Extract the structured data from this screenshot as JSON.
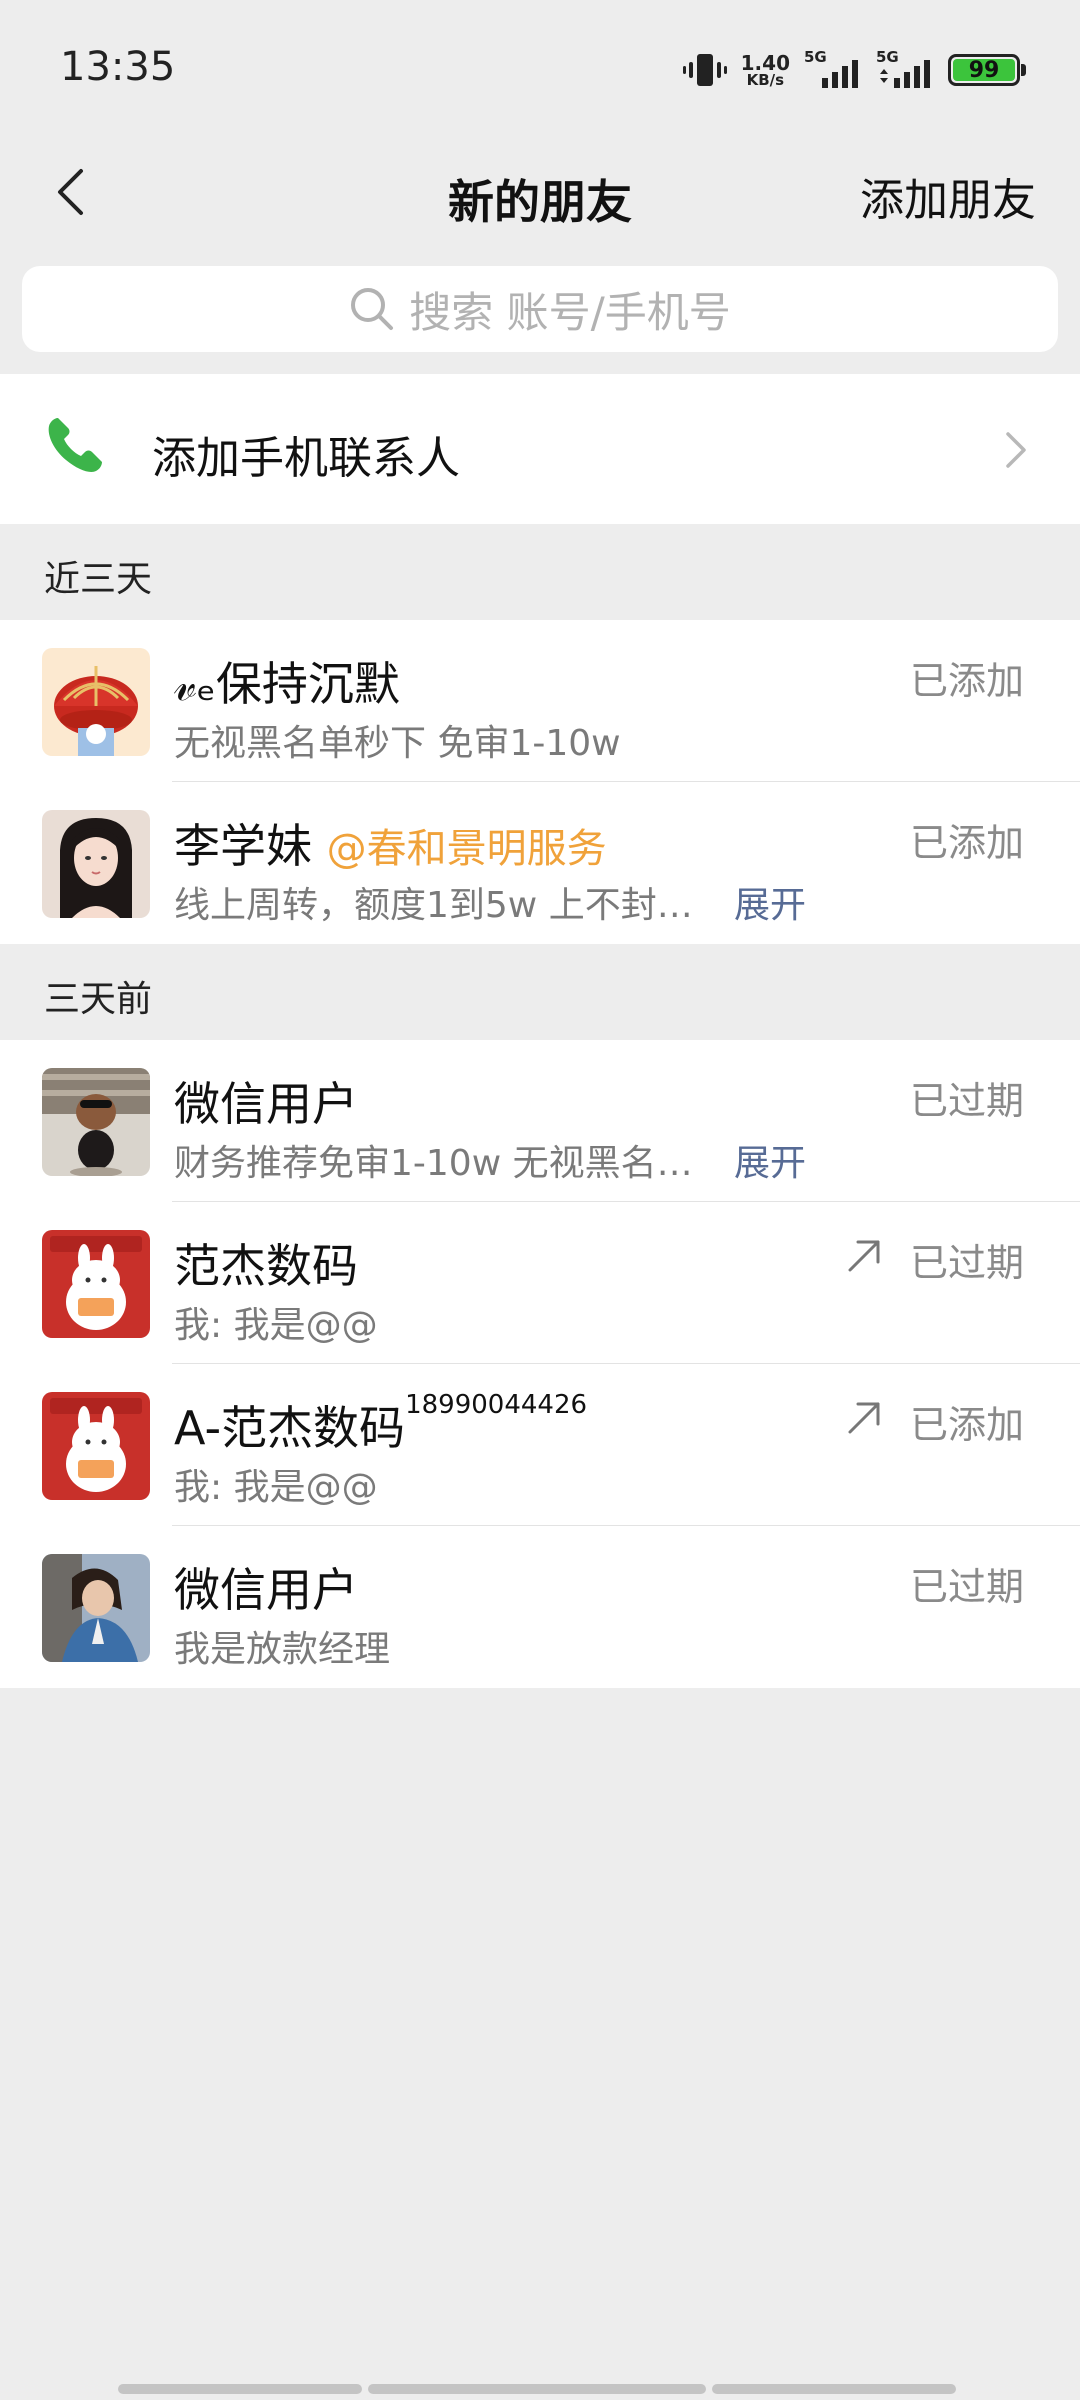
{
  "status_bar": {
    "time": "13:35",
    "net_speed": "1.40",
    "net_unit": "KB/s",
    "sim1": "5G",
    "sim2": "5G",
    "battery": "99",
    "battery_color": "#3cc43c"
  },
  "nav": {
    "title": "新的朋友",
    "action": "添加朋友"
  },
  "search": {
    "placeholder": "搜索 账号/手机号"
  },
  "phone_contacts": {
    "label": "添加手机联系人",
    "icon_color": "#3cb44a"
  },
  "sections": [
    {
      "title": "近三天",
      "items": [
        {
          "name": "𝓋ₑ保持沉默",
          "message": "无视黑名单秒下 免审1-10w",
          "status": "已添加"
        },
        {
          "name": "李学妹",
          "tag": "@春和景明服务",
          "message": "线上周转，额度1到5w 上不封…",
          "expand": "展开",
          "status": "已添加"
        }
      ]
    },
    {
      "title": "三天前",
      "items": [
        {
          "name": "微信用户",
          "message": "财务推荐免审1-10w 无视黑名…",
          "expand": "展开",
          "status": "已过期"
        },
        {
          "name": "范杰数码",
          "message": "我: 我是@@",
          "status": "已过期"
        },
        {
          "name": "A-范杰数码",
          "name_sup": "18990044426",
          "message": "我: 我是@@",
          "status": "已添加"
        },
        {
          "name": "微信用户",
          "message": "我是放款经理",
          "status": "已过期"
        }
      ]
    }
  ],
  "colors": {
    "link_blue": "#576b95",
    "tag_orange": "#f0a23a",
    "background": "#ededed"
  }
}
